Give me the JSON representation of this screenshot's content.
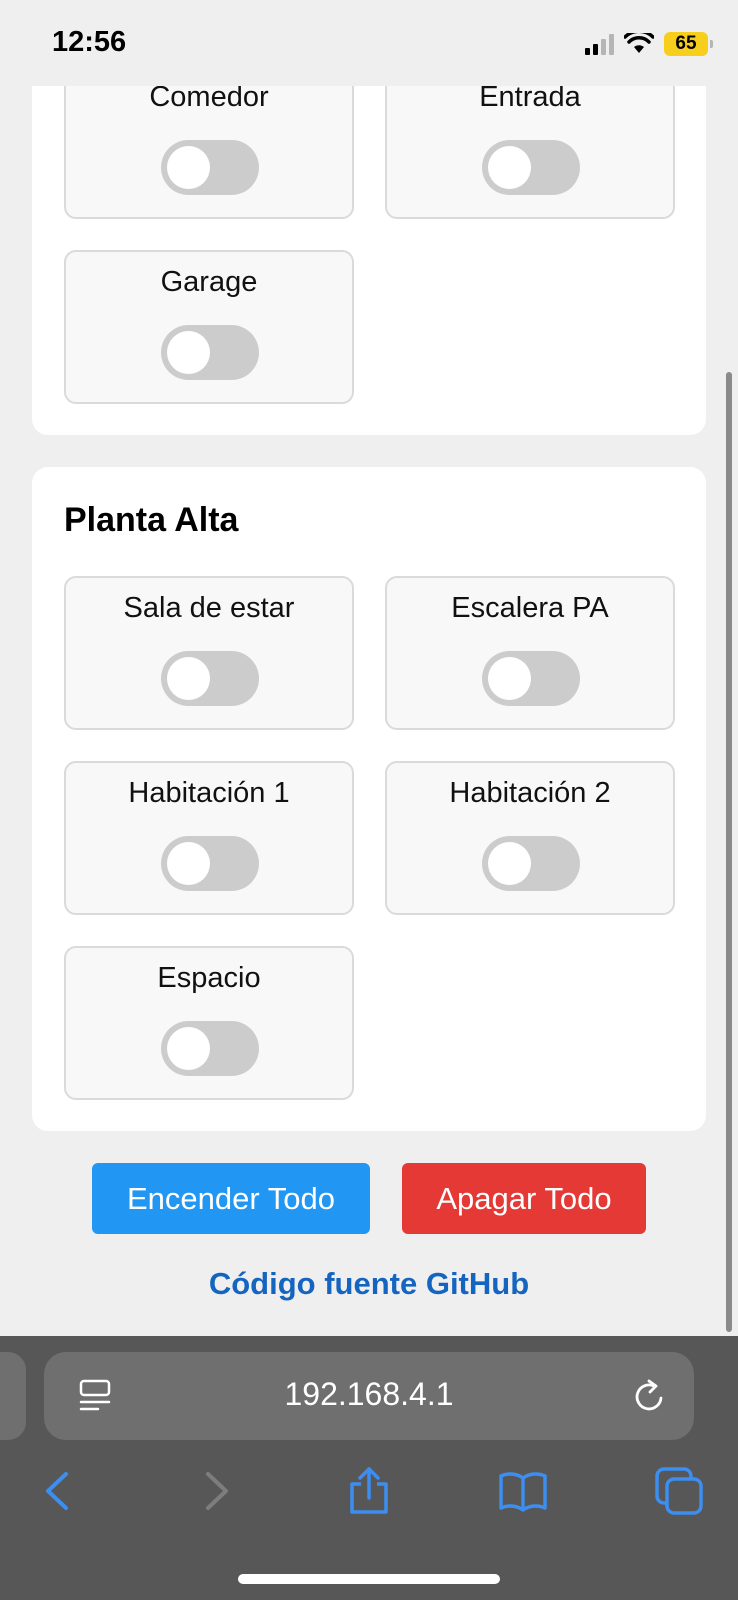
{
  "status_bar": {
    "time": "12:56",
    "battery": "65"
  },
  "sections": [
    {
      "title": "",
      "rooms": [
        {
          "name": "Comedor",
          "on": false
        },
        {
          "name": "Entrada",
          "on": false
        },
        {
          "name": "Garage",
          "on": false
        }
      ]
    },
    {
      "title": "Planta Alta",
      "rooms": [
        {
          "name": "Sala de estar",
          "on": false
        },
        {
          "name": "Escalera PA",
          "on": false
        },
        {
          "name": "Habitación 1",
          "on": false
        },
        {
          "name": "Habitación 2",
          "on": false
        },
        {
          "name": "Espacio",
          "on": false
        }
      ]
    }
  ],
  "actions": {
    "all_on": "Encender Todo",
    "all_off": "Apagar Todo"
  },
  "footer": {
    "github_link": "Código fuente GitHub"
  },
  "browser": {
    "url": "192.168.4.1"
  },
  "colors": {
    "on_button": "#2196f3",
    "off_button": "#e53935",
    "link": "#1565c0",
    "switch_off": "#cccccc"
  }
}
